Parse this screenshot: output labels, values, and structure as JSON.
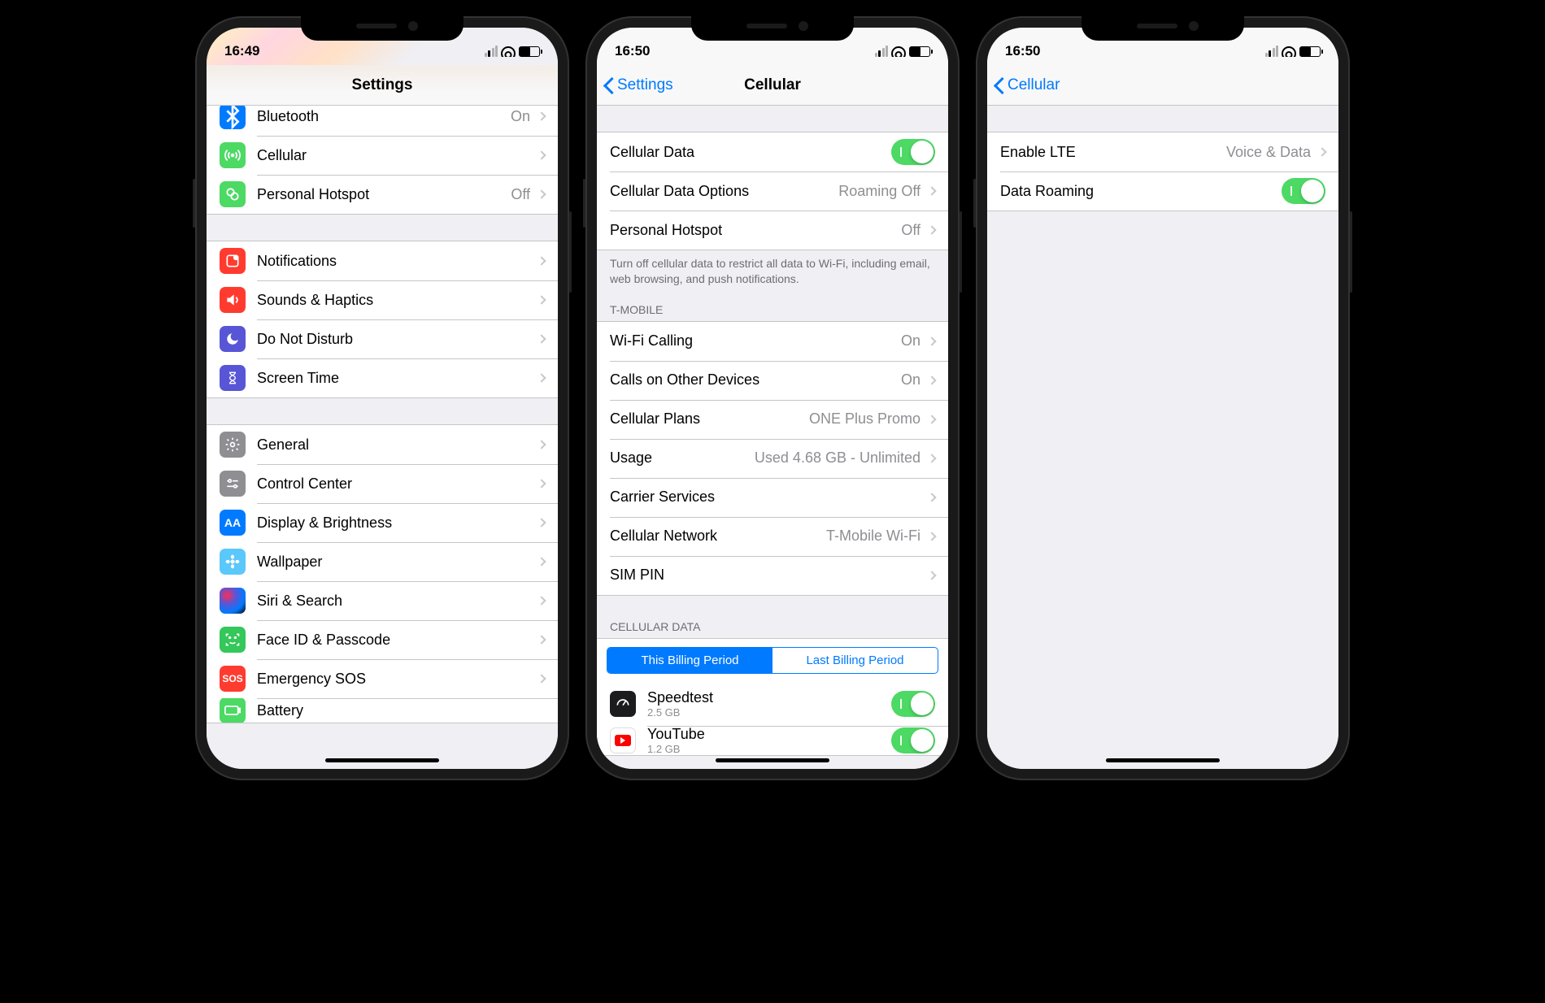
{
  "phones": {
    "settings": {
      "time": "16:49",
      "nav_title": "Settings",
      "rows_group1": [
        {
          "label": "Bluetooth",
          "detail": "On",
          "icon": "bluetooth",
          "color": "bg-blue"
        },
        {
          "label": "Cellular",
          "detail": "",
          "icon": "antenna",
          "color": "bg-green"
        },
        {
          "label": "Personal Hotspot",
          "detail": "Off",
          "icon": "link",
          "color": "bg-green"
        }
      ],
      "rows_group2": [
        {
          "label": "Notifications",
          "icon": "notif",
          "color": "bg-red"
        },
        {
          "label": "Sounds & Haptics",
          "icon": "sound",
          "color": "bg-red"
        },
        {
          "label": "Do Not Disturb",
          "icon": "moon",
          "color": "bg-purple"
        },
        {
          "label": "Screen Time",
          "icon": "hourglass",
          "color": "bg-purple"
        }
      ],
      "rows_group3": [
        {
          "label": "General",
          "icon": "gear",
          "color": "bg-gray"
        },
        {
          "label": "Control Center",
          "icon": "switches",
          "color": "bg-gray"
        },
        {
          "label": "Display & Brightness",
          "icon": "AA",
          "color": "bg-blue"
        },
        {
          "label": "Wallpaper",
          "icon": "flower",
          "color": "bg-teal"
        },
        {
          "label": "Siri & Search",
          "icon": "siri",
          "color": "bg-dark"
        },
        {
          "label": "Face ID & Passcode",
          "icon": "face",
          "color": "bg-lgreen"
        },
        {
          "label": "Emergency SOS",
          "icon": "SOS",
          "color": "bg-red"
        },
        {
          "label": "Battery",
          "icon": "battery",
          "color": "bg-green"
        }
      ]
    },
    "cellular": {
      "time": "16:50",
      "nav_back": "Settings",
      "nav_title": "Cellular",
      "cellular_data": {
        "label": "Cellular Data",
        "on": true
      },
      "cellular_options": {
        "label": "Cellular Data Options",
        "detail": "Roaming Off"
      },
      "hotspot": {
        "label": "Personal Hotspot",
        "detail": "Off"
      },
      "footer1": "Turn off cellular data to restrict all data to Wi-Fi, including email, web browsing, and push notifications.",
      "carrier_header": "T-MOBILE",
      "carrier_rows": [
        {
          "label": "Wi-Fi Calling",
          "detail": "On"
        },
        {
          "label": "Calls on Other Devices",
          "detail": "On"
        },
        {
          "label": "Cellular Plans",
          "detail": "ONE Plus Promo"
        },
        {
          "label": "Usage",
          "detail": "Used 4.68 GB - Unlimited"
        },
        {
          "label": "Carrier Services",
          "detail": ""
        },
        {
          "label": "Cellular Network",
          "detail": "T-Mobile Wi-Fi"
        },
        {
          "label": "SIM PIN",
          "detail": ""
        }
      ],
      "data_header": "CELLULAR DATA",
      "seg": {
        "left": "This Billing Period",
        "right": "Last Billing Period"
      },
      "apps": [
        {
          "label": "Speedtest",
          "sub": "2.5 GB",
          "icon": "speed",
          "color": "bg-dark",
          "on": true
        },
        {
          "label": "YouTube",
          "sub": "1.2 GB",
          "icon": "yt",
          "color": "bg-red",
          "on": true
        }
      ]
    },
    "options": {
      "time": "16:50",
      "nav_back": "Cellular",
      "lte": {
        "label": "Enable LTE",
        "detail": "Voice & Data"
      },
      "roaming": {
        "label": "Data Roaming",
        "on": true
      }
    }
  }
}
